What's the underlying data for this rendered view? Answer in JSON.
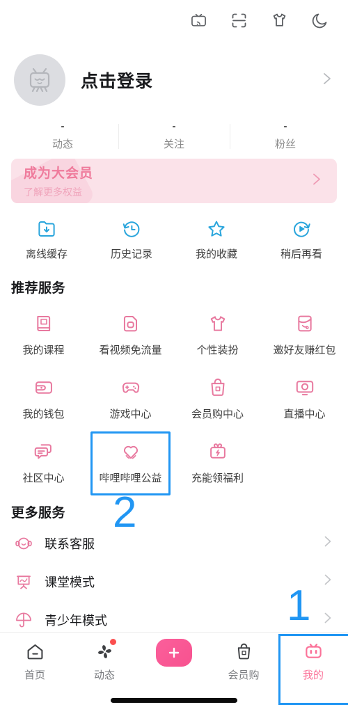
{
  "header": {
    "icons": [
      {
        "name": "cast-tv-icon",
        "label": "投屏"
      },
      {
        "name": "scan-qr-icon",
        "label": "扫一扫"
      },
      {
        "name": "tshirt-theme-icon",
        "label": "装扮"
      },
      {
        "name": "moon-dark-mode-icon",
        "label": "夜间模式"
      }
    ]
  },
  "profile": {
    "avatar_name": "default-avatar",
    "login_text": "点击登录",
    "chevron": "›"
  },
  "stats": [
    {
      "value": "-",
      "label": "动态"
    },
    {
      "value": "-",
      "label": "关注"
    },
    {
      "value": "-",
      "label": "粉丝"
    }
  ],
  "vip_banner": {
    "title": "成为大会员",
    "subtitle": "了解更多权益",
    "chevron": "›",
    "bg_color": "#fbe2e9",
    "title_color": "#ef7b9c"
  },
  "quick_actions": {
    "accent_color": "#29a5dc",
    "items": [
      {
        "label": "离线缓存",
        "icon": "offline-download-icon"
      },
      {
        "label": "历史记录",
        "icon": "history-clock-icon"
      },
      {
        "label": "我的收藏",
        "icon": "star-favorite-icon"
      },
      {
        "label": "稍后再看",
        "icon": "watch-later-icon"
      }
    ]
  },
  "recommended": {
    "title": "推荐服务",
    "accent_color": "#e8799f",
    "items": [
      {
        "label": "我的课程",
        "icon": "course-book-icon"
      },
      {
        "label": "看视频免流量",
        "icon": "sim-card-icon"
      },
      {
        "label": "个性装扮",
        "icon": "tshirt-dressup-icon"
      },
      {
        "label": "邀好友赚红包",
        "icon": "red-packet-icon"
      },
      {
        "label": "我的钱包",
        "icon": "wallet-icon"
      },
      {
        "label": "游戏中心",
        "icon": "gamepad-icon"
      },
      {
        "label": "会员购中心",
        "icon": "shopping-bag-icon"
      },
      {
        "label": "直播中心",
        "icon": "live-broadcast-icon"
      },
      {
        "label": "社区中心",
        "icon": "chat-bubbles-icon"
      },
      {
        "label": "哔哩哔哩公益",
        "icon": "heart-charity-icon",
        "highlighted": true
      },
      {
        "label": "充能领福利",
        "icon": "charge-gift-icon"
      }
    ]
  },
  "more_services": {
    "title": "更多服务",
    "items": [
      {
        "label": "联系客服",
        "icon": "headset-support-icon",
        "chevron": "›"
      },
      {
        "label": "课堂模式",
        "icon": "classroom-board-icon",
        "chevron": "›"
      },
      {
        "label": "青少年模式",
        "icon": "umbrella-teen-icon",
        "chevron": "›"
      }
    ]
  },
  "tabbar": {
    "active_color": "#fb7299",
    "inactive_color": "#7a7c80",
    "items": [
      {
        "label": "首页",
        "icon": "home-icon",
        "active": false
      },
      {
        "label": "动态",
        "icon": "pinwheel-dynamic-icon",
        "active": false,
        "badge": true
      },
      {
        "label": "",
        "icon": "plus-add-icon",
        "active": false,
        "is_plus": true
      },
      {
        "label": "会员购",
        "icon": "shopping-bag-icon",
        "active": false
      },
      {
        "label": "我的",
        "icon": "bilibili-tv-icon",
        "active": true,
        "highlighted": true
      }
    ]
  },
  "annotations": [
    {
      "text": "2",
      "color": "#2196f3"
    },
    {
      "text": "1",
      "color": "#2196f3"
    }
  ]
}
